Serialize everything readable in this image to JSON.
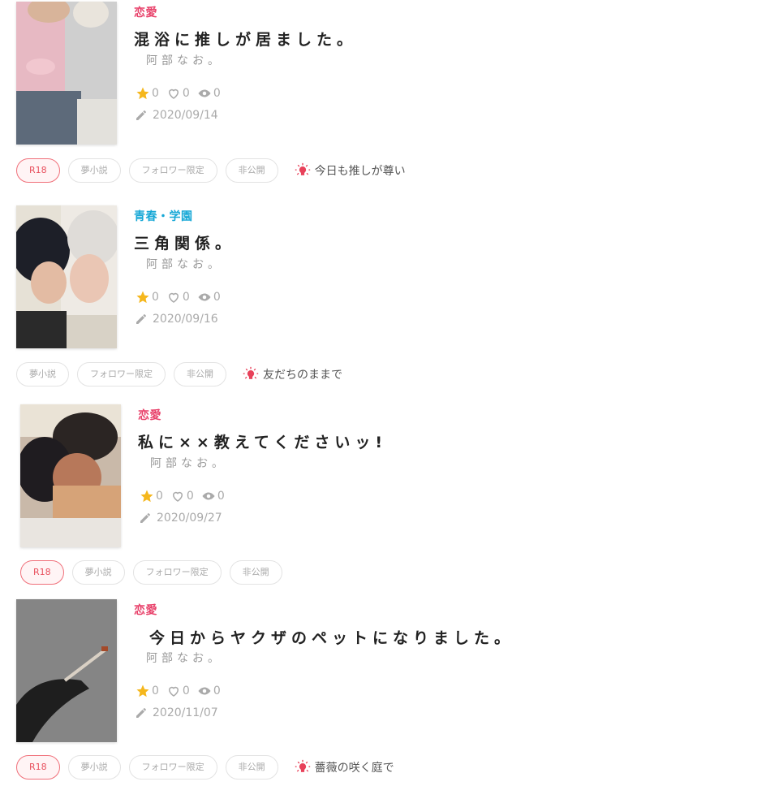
{
  "colors": {
    "love": "#e8416a",
    "youth": "#17a8d6",
    "star": "#f5b71d",
    "r18": "#e8505e"
  },
  "entries": [
    {
      "genre": "恋愛",
      "genre_color": "love",
      "title": "混浴に推しが居ました。",
      "author": "阿部なお。",
      "stars": "0",
      "likes": "0",
      "views": "0",
      "date": "2020/09/14",
      "tags": [
        "R18",
        "夢小説",
        "フォロワー限定",
        "非公開"
      ],
      "memo": "今日も推しが尊い",
      "cover_icon": "cover-photo-couple-pink"
    },
    {
      "genre": "青春・学園",
      "genre_color": "youth",
      "title": "三角関係。",
      "author": "阿部なお。",
      "stars": "0",
      "likes": "0",
      "views": "0",
      "date": "2020/09/16",
      "tags": [
        "夢小説",
        "フォロワー限定",
        "非公開"
      ],
      "memo": "友だちのままで",
      "cover_icon": "cover-photo-two-boys"
    },
    {
      "genre": "恋愛",
      "genre_color": "love",
      "title": "私に××教えてくださいッ!",
      "author": "阿部なお。",
      "stars": "0",
      "likes": "0",
      "views": "0",
      "date": "2020/09/27",
      "tags": [
        "R18",
        "夢小説",
        "フォロワー限定",
        "非公開"
      ],
      "memo": "",
      "cover_icon": "cover-photo-embrace"
    },
    {
      "genre": "恋愛",
      "genre_color": "love",
      "title": "今日からヤクザのペットになりました。",
      "author": "阿部なお。",
      "stars": "0",
      "likes": "0",
      "views": "0",
      "date": "2020/11/07",
      "tags": [
        "R18",
        "夢小説",
        "フォロワー限定",
        "非公開"
      ],
      "memo": "薔薇の咲く庭で",
      "cover_icon": "cover-photo-hand-cigarette"
    }
  ]
}
